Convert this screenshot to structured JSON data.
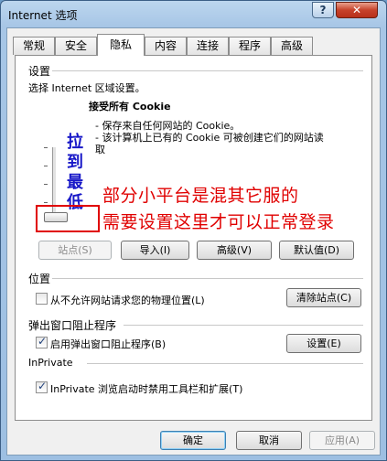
{
  "window": {
    "title": "Internet 选项",
    "help_glyph": "?",
    "close_glyph": "✕"
  },
  "tabs": [
    {
      "label": "常规"
    },
    {
      "label": "安全"
    },
    {
      "label": "隐私"
    },
    {
      "label": "内容"
    },
    {
      "label": "连接"
    },
    {
      "label": "程序"
    },
    {
      "label": "高级"
    }
  ],
  "settings": {
    "header": "设置",
    "instruction": "选择 Internet 区域设置。",
    "level_title": "接受所有 Cookie",
    "bullet1": "- 保存来自任何网站的 Cookie。",
    "bullet2": "- 该计算机上已有的 Cookie 可被创建它们的网站读",
    "bullet2_cont": "取",
    "slider_level": 0.0
  },
  "annotation": {
    "vertical": [
      "拉",
      "到",
      "最",
      "低"
    ],
    "line1": "部分小平台是混其它服的",
    "line2": "需要设置这里才可以正常登录"
  },
  "buttons_row1": {
    "sites": "站点(S)",
    "import": "导入(I)",
    "advanced": "高级(V)",
    "default": "默认值(D)"
  },
  "location": {
    "header": "位置",
    "checkbox_label": "从不允许网站请求您的物理位置(L)",
    "checked": false,
    "clear_sites": "清除站点(C)"
  },
  "popup": {
    "header": "弹出窗口阻止程序",
    "checkbox_label": "启用弹出窗口阻止程序(B)",
    "checked": true,
    "settings_button": "设置(E)"
  },
  "inprivate": {
    "header": "InPrivate",
    "checkbox_label": "InPrivate 浏览启动时禁用工具栏和扩展(T)",
    "checked": true
  },
  "footer": {
    "ok": "确定",
    "cancel": "取消",
    "apply": "应用(A)"
  }
}
